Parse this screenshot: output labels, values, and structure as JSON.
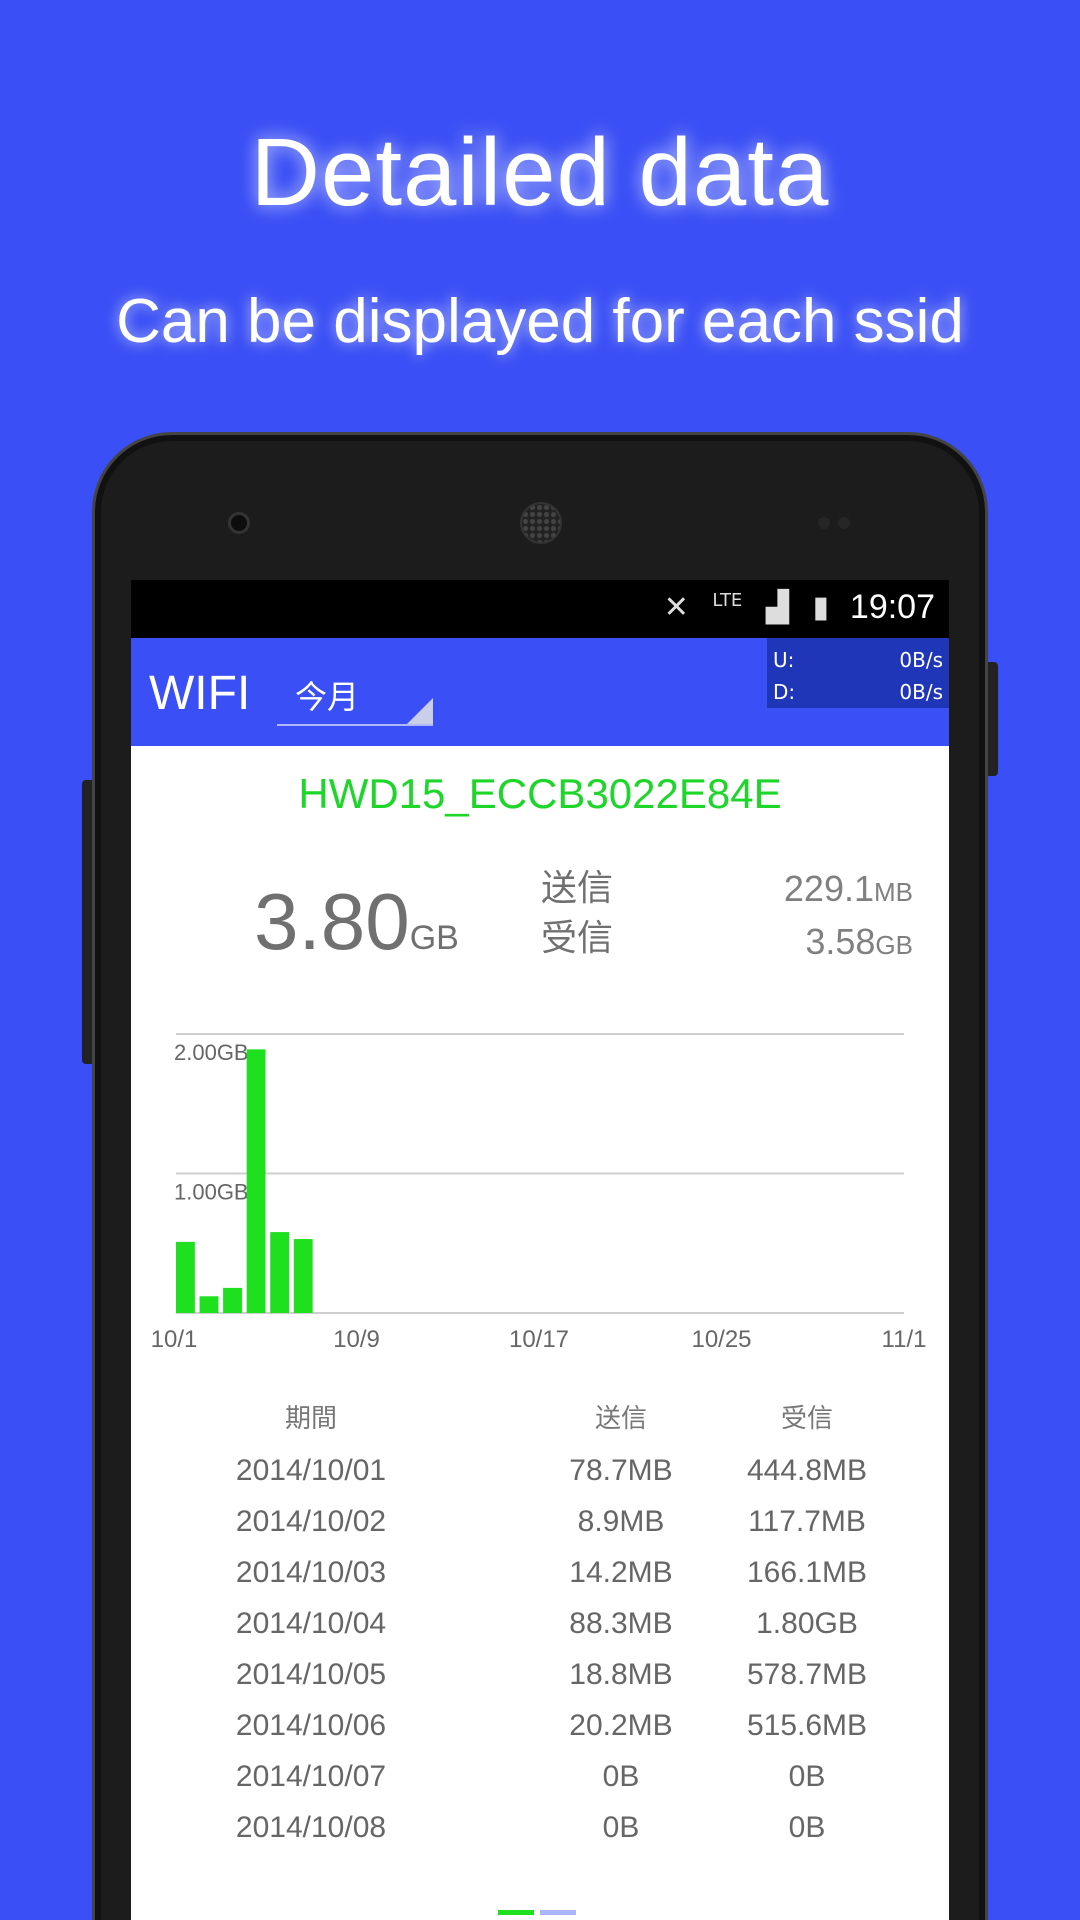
{
  "promo": {
    "headline": "Detailed data",
    "subheadline": "Can be displayed for each ssid"
  },
  "status_bar": {
    "time": "19:07",
    "network": "LTE",
    "icons": [
      "mute-icon",
      "lte-signal-icon",
      "battery-charging-icon"
    ]
  },
  "app_bar": {
    "title": "WIFI",
    "period_selected": "今月"
  },
  "speed": {
    "up_label": "U:",
    "up_value": "0B/s",
    "down_label": "D:",
    "down_value": "0B/s"
  },
  "summary": {
    "ssid": "HWD15_ECCB3022E84E",
    "total_value": "3.80",
    "total_unit": "GB",
    "sent_label": "送信",
    "recv_label": "受信",
    "sent_value": "229.1",
    "sent_unit": "MB",
    "recv_value": "3.58",
    "recv_unit": "GB"
  },
  "chart_data": {
    "type": "bar",
    "x": [
      "10/1",
      "10/2",
      "10/3",
      "10/4",
      "10/5",
      "10/6",
      "10/7",
      "10/8"
    ],
    "values_gb": [
      0.51,
      0.12,
      0.18,
      1.89,
      0.58,
      0.53,
      0,
      0
    ],
    "ylim": [
      0,
      2.0
    ],
    "grid_values": [
      1.0,
      2.0
    ],
    "grid_labels": [
      "1.00GB",
      "2.00GB"
    ],
    "x_tick_labels": [
      "10/1",
      "10/9",
      "10/17",
      "10/25",
      "11/1"
    ],
    "color": "#1ee01e"
  },
  "table": {
    "headers": [
      "期間",
      "送信",
      "受信"
    ],
    "rows": [
      [
        "2014/10/01",
        "78.7MB",
        "444.8MB"
      ],
      [
        "2014/10/02",
        "8.9MB",
        "117.7MB"
      ],
      [
        "2014/10/03",
        "14.2MB",
        "166.1MB"
      ],
      [
        "2014/10/04",
        "88.3MB",
        "1.80GB"
      ],
      [
        "2014/10/05",
        "18.8MB",
        "578.7MB"
      ],
      [
        "2014/10/06",
        "20.2MB",
        "515.6MB"
      ],
      [
        "2014/10/07",
        "0B",
        "0B"
      ],
      [
        "2014/10/08",
        "0B",
        "0B"
      ]
    ]
  },
  "colors": {
    "background": "#3a4ff5",
    "accent_green": "#1ed62a",
    "speed_box": "#2036b8"
  }
}
